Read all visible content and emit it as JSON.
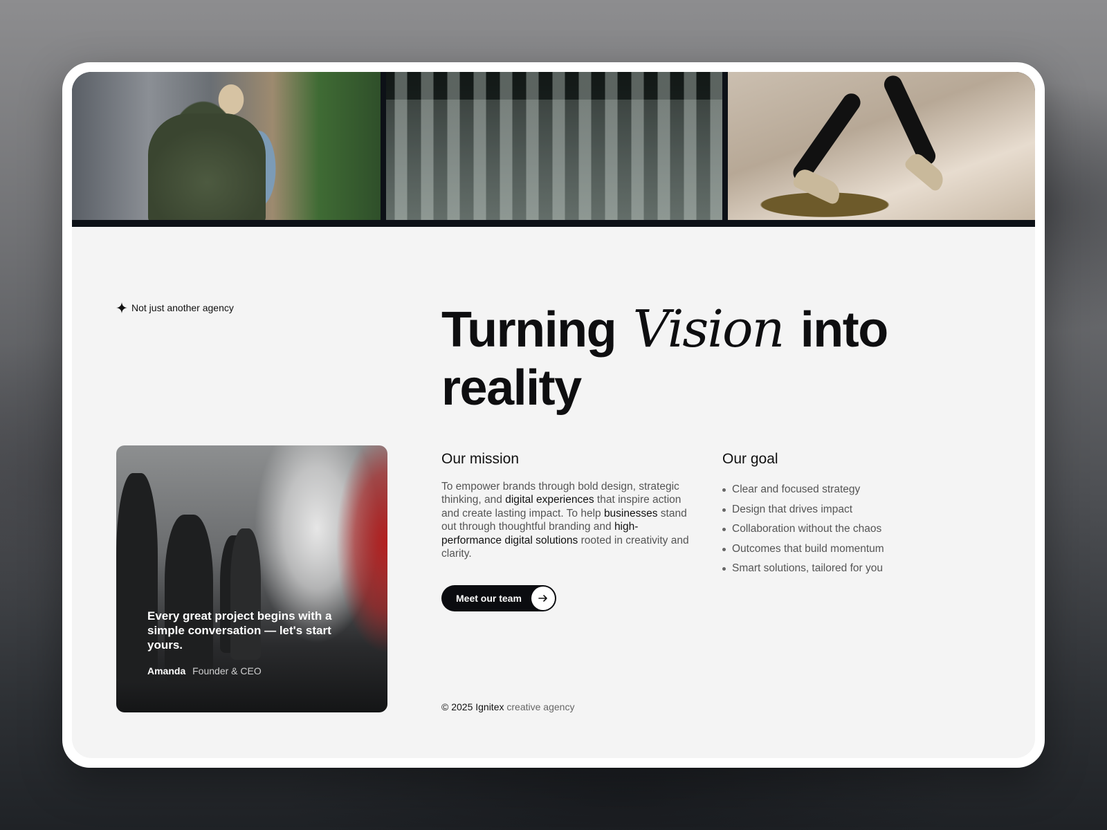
{
  "tagline": "Not just another agency",
  "headline": {
    "before": "Turning",
    "script": "Vision",
    "after": "into reality"
  },
  "quote_card": {
    "text": "Every great project begins with a simple conversation — let's start yours.",
    "author_name": "Amanda",
    "author_role": "Founder & CEO"
  },
  "mission": {
    "title": "Our mission",
    "segments": [
      "To empower brands through bold design, strategic thinking, and ",
      "digital experiences",
      " that inspire action and create lasting impact. To help ",
      "businesses",
      " stand out through thoughtful branding and ",
      "high-performance digital solutions",
      " rooted in creativity and clarity."
    ]
  },
  "goal": {
    "title": "Our goal",
    "items": [
      "Clear and focused strategy",
      "Design that drives impact",
      "Collaboration without the chaos",
      "Outcomes that build momentum",
      "Smart solutions, tailored for you"
    ]
  },
  "cta": {
    "label": "Meet our team",
    "icon": "arrow-right-icon"
  },
  "footer": {
    "copyright": "© 2025 Ignitex",
    "suffix": "creative agency"
  },
  "colors": {
    "background": "#f4f4f4",
    "text": "#111111",
    "muted": "#555555",
    "button": "#0b0c10"
  }
}
